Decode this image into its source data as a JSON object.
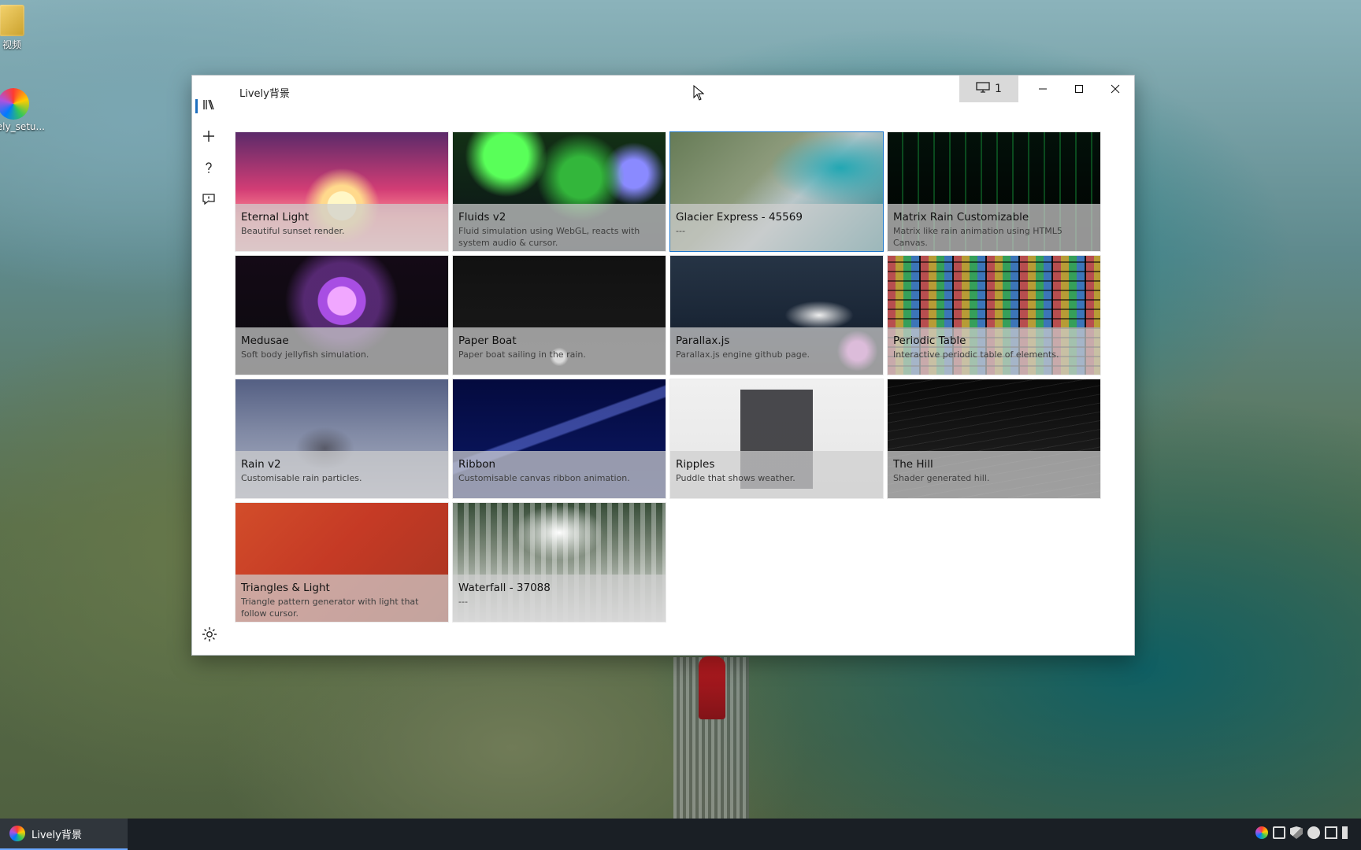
{
  "desktop": {
    "icons": [
      {
        "label": "视频"
      },
      {
        "label": "lively_setu..."
      }
    ]
  },
  "window": {
    "title": "Lively背景",
    "display_selector": {
      "label": "1"
    },
    "buttons": {
      "minimize": "minimize-icon",
      "maximize": "maximize-icon",
      "close": "close-icon"
    }
  },
  "nav": {
    "items": [
      {
        "name": "library",
        "icon": "library-icon"
      },
      {
        "name": "add",
        "icon": "plus-icon"
      },
      {
        "name": "help",
        "icon": "help-icon"
      },
      {
        "name": "feedback",
        "icon": "feedback-icon"
      }
    ],
    "settings_icon": "gear-icon"
  },
  "library": {
    "items": [
      {
        "title": "Eternal Light",
        "desc": "Beautiful sunset render."
      },
      {
        "title": "Fluids v2",
        "desc": "Fluid simulation using WebGL, reacts with system audio & cursor."
      },
      {
        "title": "Glacier Express - 45569",
        "desc": "---"
      },
      {
        "title": "Matrix Rain Customizable",
        "desc": "Matrix like rain animation using HTML5 Canvas."
      },
      {
        "title": "Medusae",
        "desc": "Soft body jellyfish simulation."
      },
      {
        "title": "Paper Boat",
        "desc": "Paper boat sailing in the rain."
      },
      {
        "title": "Parallax.js",
        "desc": "Parallax.js engine github page."
      },
      {
        "title": "Periodic Table",
        "desc": "Interactive periodic table of elements."
      },
      {
        "title": "Rain v2",
        "desc": "Customisable rain particles."
      },
      {
        "title": "Ribbon",
        "desc": "Customisable canvas ribbon animation."
      },
      {
        "title": "Ripples",
        "desc": "Puddle that shows weather."
      },
      {
        "title": "The Hill",
        "desc": "Shader generated hill."
      },
      {
        "title": "Triangles & Light",
        "desc": "Triangle pattern generator with light that follow cursor."
      },
      {
        "title": "Waterfall - 37088",
        "desc": "---"
      }
    ],
    "selected_index": 2
  },
  "taskbar": {
    "active_app": "Lively背景"
  }
}
